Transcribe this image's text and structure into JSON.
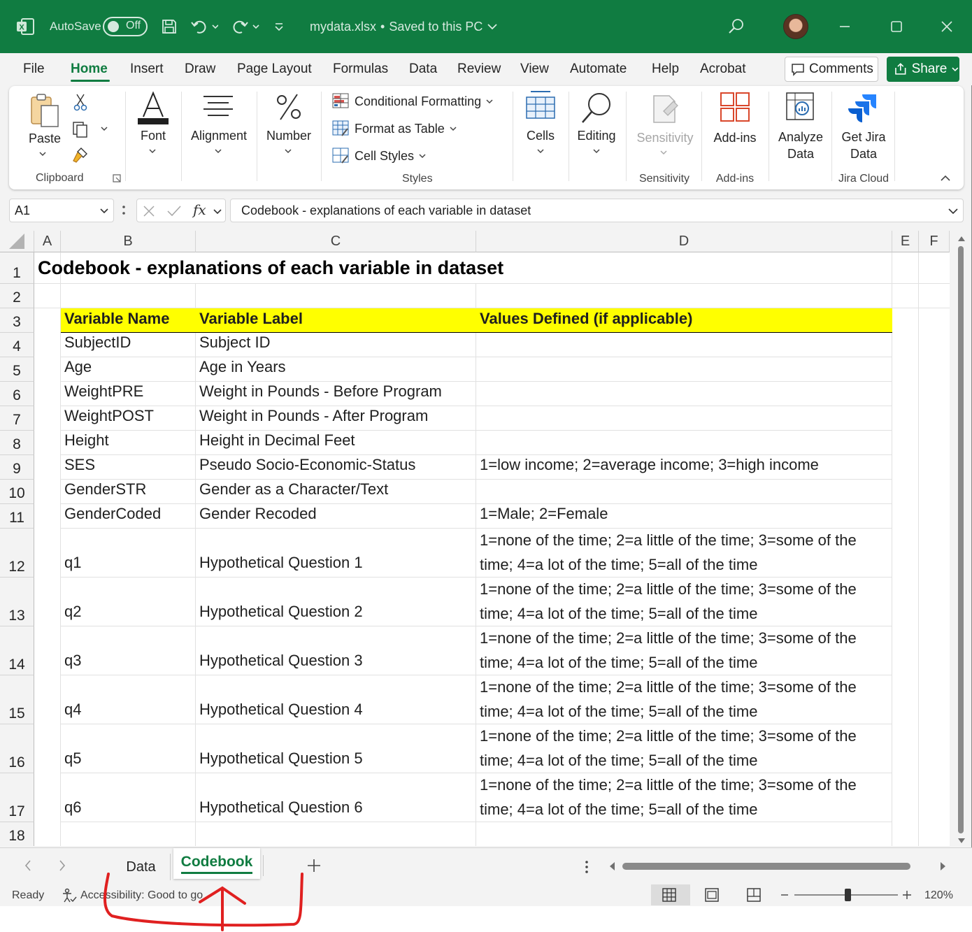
{
  "titlebar": {
    "autosave_label": "AutoSave",
    "autosave_state": "Off",
    "filename": "mydata.xlsx",
    "separator": "•",
    "save_status": "Saved to this PC"
  },
  "ribbon_tabs": [
    "File",
    "Home",
    "Insert",
    "Draw",
    "Page Layout",
    "Formulas",
    "Data",
    "Review",
    "View",
    "Automate",
    "Help",
    "Acrobat"
  ],
  "active_tab": "Home",
  "comments_label": "Comments",
  "share_label": "Share",
  "ribbon": {
    "paste": "Paste",
    "clipboard": "Clipboard",
    "font": "Font",
    "alignment": "Alignment",
    "number": "Number",
    "conditional_formatting": "Conditional Formatting",
    "format_as_table": "Format as Table",
    "cell_styles": "Cell Styles",
    "styles": "Styles",
    "cells": "Cells",
    "editing": "Editing",
    "sensitivity": "Sensitivity",
    "sensitivity_group": "Sensitivity",
    "addins": "Add-ins",
    "addins_group": "Add-ins",
    "analyze_data_1": "Analyze",
    "analyze_data_2": "Data",
    "get_jira_1": "Get Jira",
    "get_jira_2": "Data",
    "jira_group": "Jira Cloud"
  },
  "formula_bar": {
    "name_box": "A1",
    "fx": "fx",
    "content": "Codebook - explanations of each variable in dataset"
  },
  "columns": [
    "A",
    "B",
    "C",
    "D",
    "E",
    "F"
  ],
  "rows": [
    "1",
    "2",
    "3",
    "4",
    "5",
    "6",
    "7",
    "8",
    "9",
    "10",
    "11",
    "12",
    "13",
    "14",
    "15",
    "16",
    "17",
    "18"
  ],
  "sheet": {
    "title": "Codebook - explanations of each variable in dataset",
    "headers": [
      "Variable Name",
      "Variable Label",
      "Values Defined (if applicable)"
    ],
    "header_fill": "#ffff00",
    "data": [
      [
        "SubjectID",
        "Subject ID",
        ""
      ],
      [
        "Age",
        "Age in Years",
        ""
      ],
      [
        "WeightPRE",
        "Weight in Pounds - Before Program",
        ""
      ],
      [
        "WeightPOST",
        "Weight in Pounds - After Program",
        ""
      ],
      [
        "Height",
        "Height in Decimal Feet",
        ""
      ],
      [
        "SES",
        "Pseudo Socio-Economic-Status",
        "1=low income; 2=average income; 3=high income"
      ],
      [
        "GenderSTR",
        "Gender as a Character/Text",
        ""
      ],
      [
        "GenderCoded",
        "Gender Recoded",
        "1=Male; 2=Female"
      ],
      [
        "q1",
        "Hypothetical Question 1",
        "1=none of the time; 2=a little of the time; 3=some of the time; 4=a lot of the time; 5=all of the time"
      ],
      [
        "q2",
        "Hypothetical Question 2",
        "1=none of the time; 2=a little of the time; 3=some of the time; 4=a lot of the time; 5=all of the time"
      ],
      [
        "q3",
        "Hypothetical Question 3",
        "1=none of the time; 2=a little of the time; 3=some of the time; 4=a lot of the time; 5=all of the time"
      ],
      [
        "q4",
        "Hypothetical Question 4",
        "1=none of the time; 2=a little of the time; 3=some of the time; 4=a lot of the time; 5=all of the time"
      ],
      [
        "q5",
        "Hypothetical Question 5",
        "1=none of the time; 2=a little of the time; 3=some of the time; 4=a lot of the time; 5=all of the time"
      ],
      [
        "q6",
        "Hypothetical Question 6",
        "1=none of the time; 2=a little of the time; 3=some of the time; 4=a lot of the time; 5=all of the time"
      ]
    ]
  },
  "sheet_tabs": [
    "Data",
    "Codebook"
  ],
  "active_sheet": "Codebook",
  "status": {
    "ready": "Ready",
    "accessibility": "Accessibility: Good to go",
    "zoom": "120%"
  },
  "colors": {
    "brand": "#107c41",
    "annotation": "#e02020"
  }
}
